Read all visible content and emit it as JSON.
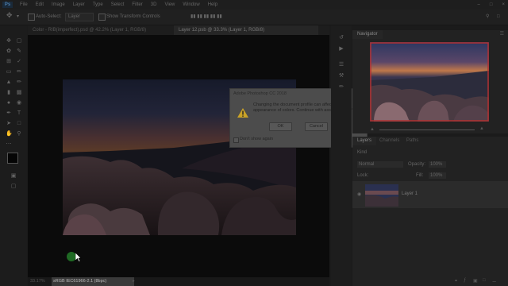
{
  "menubar": {
    "logo": "Ps",
    "items": [
      "File",
      "Edit",
      "Image",
      "Layer",
      "Type",
      "Select",
      "Filter",
      "3D",
      "View",
      "Window",
      "Help"
    ]
  },
  "options": {
    "auto_select": "Auto-Select:",
    "auto_select_value": "Layer",
    "show_transform": "Show Transform Controls"
  },
  "tabs": [
    {
      "label": "Color - RIB(imperfect).psd @ 42.2% (Layer 1, RGB/8)",
      "active": false
    },
    {
      "label": "Layer 12.psb @ 33.3% (Layer 1, RGB/8)",
      "active": true
    }
  ],
  "status": {
    "zoom": "33.17%",
    "profile": "sRGB IEC61966-2.1 (8bpc)"
  },
  "dialog": {
    "title": "Adobe Photoshop CC 2018",
    "message": "Changing the document profile can affect the appearance of colors. Continue with assign profile?",
    "ok": "OK",
    "cancel": "Cancel",
    "dont_show": "Don't show again"
  },
  "navigator": {
    "title": "Navigator"
  },
  "layers_panel": {
    "tabs": [
      "Layers",
      "Channels",
      "Paths"
    ],
    "kind": "Kind",
    "blend": "Normal",
    "opacity_label": "Opacity:",
    "opacity": "100%",
    "lock_label": "Lock:",
    "fill_label": "Fill:",
    "fill": "100%",
    "layer_name": "Layer 1"
  },
  "colors": {
    "accent_green": "#1f6a24",
    "dialog_bg": "#4c4c4c"
  }
}
